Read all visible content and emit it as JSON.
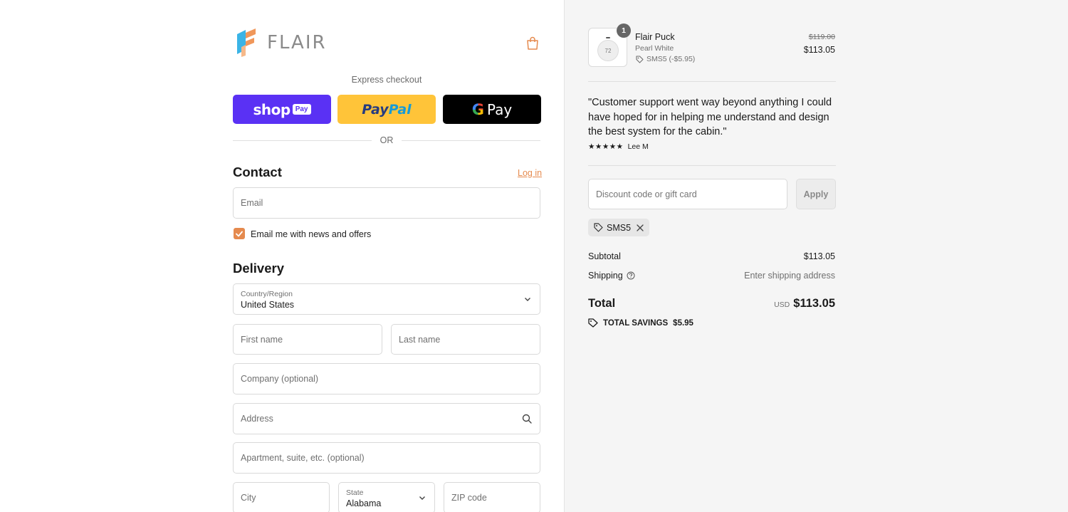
{
  "brand": {
    "name": "FLAIR",
    "accent": "#e58a4e"
  },
  "express": {
    "label": "Express checkout",
    "shop_pay": {
      "word": "shop",
      "badge": "Pay",
      "color": "#5a31f4"
    },
    "paypal": {
      "part1": "Pay",
      "part2": "Pal",
      "color": "#ffc439"
    },
    "google_pay": {
      "g": "G",
      "word": "Pay",
      "color": "#000000"
    },
    "divider_text": "OR"
  },
  "contact": {
    "heading": "Contact",
    "login_link": "Log in",
    "email_placeholder": "Email",
    "newsletter_label": "Email me with news and offers",
    "newsletter_checked": true
  },
  "delivery": {
    "heading": "Delivery",
    "country": {
      "label": "Country/Region",
      "value": "United States"
    },
    "first_name_placeholder": "First name",
    "last_name_placeholder": "Last name",
    "company_placeholder": "Company (optional)",
    "address_placeholder": "Address",
    "apartment_placeholder": "Apartment, suite, etc. (optional)",
    "city_placeholder": "City",
    "state": {
      "label": "State",
      "value": "Alabama"
    },
    "zip_placeholder": "ZIP code"
  },
  "order": {
    "item": {
      "quantity": "1",
      "name": "Flair Puck",
      "variant": "Pearl White",
      "discount": "SMS5 (-$5.95)",
      "thumb_text": "72",
      "original_price": "$119.00",
      "price": "$113.05"
    },
    "testimonial": {
      "quote": "\"Customer support went way beyond anything I could have hoped for in helping me understand and design the best system for the cabin.\"",
      "stars": "★★★★★",
      "author": "Lee M"
    },
    "discount": {
      "placeholder": "Discount code or gift card",
      "apply_label": "Apply",
      "applied_code": "SMS5"
    },
    "summary": {
      "subtotal_label": "Subtotal",
      "subtotal_value": "$113.05",
      "shipping_label": "Shipping",
      "shipping_value": "Enter shipping address",
      "total_label": "Total",
      "currency": "USD",
      "total_value": "$113.05",
      "savings_label": "TOTAL SAVINGS",
      "savings_value": "$5.95"
    }
  }
}
